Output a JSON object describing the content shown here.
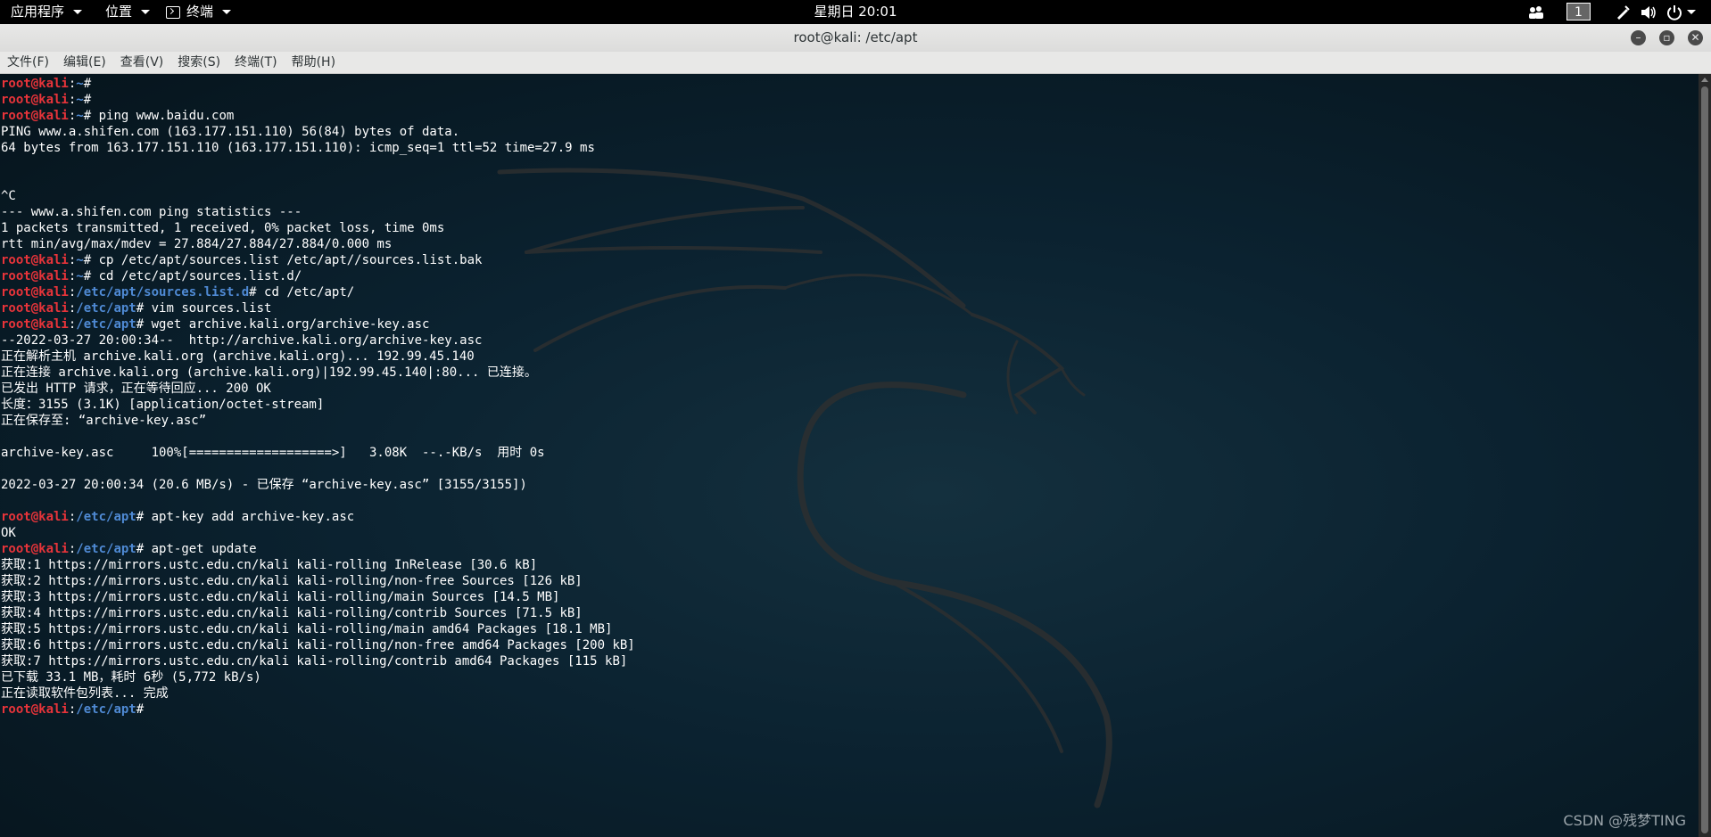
{
  "top_panel": {
    "apps_menu": "应用程序",
    "places_menu": "位置",
    "terminal_menu": "终端",
    "clock": "星期日 20:01",
    "workspace": "1",
    "tray_icons": [
      "people-icon",
      "pen-icon",
      "volume-icon",
      "power-icon"
    ]
  },
  "window": {
    "title": "root@kali: /etc/apt",
    "buttons": [
      "minimize-icon",
      "maximize-icon",
      "close-icon"
    ]
  },
  "menubar": {
    "items": [
      "文件(F)",
      "编辑(E)",
      "查看(V)",
      "搜索(S)",
      "终端(T)",
      "帮助(H)"
    ]
  },
  "terminal": {
    "colors": {
      "user": "#e8343a",
      "path": "#4f8ad4",
      "text": "#ffffff",
      "background": "#0b2230"
    },
    "lines": [
      {
        "type": "prompt",
        "user": "root@kali",
        "path": "~",
        "cmd": ""
      },
      {
        "type": "prompt",
        "user": "root@kali",
        "path": "~",
        "cmd": ""
      },
      {
        "type": "prompt",
        "user": "root@kali",
        "path": "~",
        "cmd": " ping www.baidu.com"
      },
      {
        "type": "out",
        "text": "PING www.a.shifen.com (163.177.151.110) 56(84) bytes of data."
      },
      {
        "type": "out",
        "text": "64 bytes from 163.177.151.110 (163.177.151.110): icmp_seq=1 ttl=52 time=27.9 ms"
      },
      {
        "type": "out",
        "text": ""
      },
      {
        "type": "out",
        "text": ""
      },
      {
        "type": "out",
        "text": "^C"
      },
      {
        "type": "out",
        "text": "--- www.a.shifen.com ping statistics ---"
      },
      {
        "type": "out",
        "text": "1 packets transmitted, 1 received, 0% packet loss, time 0ms"
      },
      {
        "type": "out",
        "text": "rtt min/avg/max/mdev = 27.884/27.884/27.884/0.000 ms"
      },
      {
        "type": "prompt",
        "user": "root@kali",
        "path": "~",
        "cmd": " cp /etc/apt/sources.list /etc/apt//sources.list.bak"
      },
      {
        "type": "prompt",
        "user": "root@kali",
        "path": "~",
        "cmd": " cd /etc/apt/sources.list.d/"
      },
      {
        "type": "prompt",
        "user": "root@kali",
        "path": "/etc/apt/sources.list.d",
        "cmd": " cd /etc/apt/"
      },
      {
        "type": "prompt",
        "user": "root@kali",
        "path": "/etc/apt",
        "cmd": " vim sources.list"
      },
      {
        "type": "prompt",
        "user": "root@kali",
        "path": "/etc/apt",
        "cmd": " wget archive.kali.org/archive-key.asc"
      },
      {
        "type": "out",
        "text": "--2022-03-27 20:00:34--  http://archive.kali.org/archive-key.asc"
      },
      {
        "type": "out",
        "text": "正在解析主机 archive.kali.org (archive.kali.org)... 192.99.45.140"
      },
      {
        "type": "out",
        "text": "正在连接 archive.kali.org (archive.kali.org)|192.99.45.140|:80... 已连接。"
      },
      {
        "type": "out",
        "text": "已发出 HTTP 请求，正在等待回应... 200 OK"
      },
      {
        "type": "out",
        "text": "长度：3155 (3.1K) [application/octet-stream]"
      },
      {
        "type": "out",
        "text": "正在保存至: “archive-key.asc”"
      },
      {
        "type": "out",
        "text": ""
      },
      {
        "type": "out",
        "text": "archive-key.asc     100%[===================>]   3.08K  --.-KB/s  用时 0s"
      },
      {
        "type": "out",
        "text": ""
      },
      {
        "type": "out",
        "text": "2022-03-27 20:00:34 (20.6 MB/s) - 已保存 “archive-key.asc” [3155/3155])"
      },
      {
        "type": "out",
        "text": ""
      },
      {
        "type": "prompt",
        "user": "root@kali",
        "path": "/etc/apt",
        "cmd": " apt-key add archive-key.asc"
      },
      {
        "type": "out",
        "text": "OK"
      },
      {
        "type": "prompt",
        "user": "root@kali",
        "path": "/etc/apt",
        "cmd": " apt-get update"
      },
      {
        "type": "out",
        "text": "获取:1 https://mirrors.ustc.edu.cn/kali kali-rolling InRelease [30.6 kB]"
      },
      {
        "type": "out",
        "text": "获取:2 https://mirrors.ustc.edu.cn/kali kali-rolling/non-free Sources [126 kB]"
      },
      {
        "type": "out",
        "text": "获取:3 https://mirrors.ustc.edu.cn/kali kali-rolling/main Sources [14.5 MB]"
      },
      {
        "type": "out",
        "text": "获取:4 https://mirrors.ustc.edu.cn/kali kali-rolling/contrib Sources [71.5 kB]"
      },
      {
        "type": "out",
        "text": "获取:5 https://mirrors.ustc.edu.cn/kali kali-rolling/main amd64 Packages [18.1 MB]"
      },
      {
        "type": "out",
        "text": "获取:6 https://mirrors.ustc.edu.cn/kali kali-rolling/non-free amd64 Packages [200 kB]"
      },
      {
        "type": "out",
        "text": "获取:7 https://mirrors.ustc.edu.cn/kali kali-rolling/contrib amd64 Packages [115 kB]"
      },
      {
        "type": "out",
        "text": "已下载 33.1 MB，耗时 6秒 (5,772 kB/s)"
      },
      {
        "type": "out",
        "text": "正在读取软件包列表... 完成"
      },
      {
        "type": "prompt",
        "user": "root@kali",
        "path": "/etc/apt",
        "cmd": ""
      }
    ]
  },
  "watermark": "CSDN @残梦TING"
}
